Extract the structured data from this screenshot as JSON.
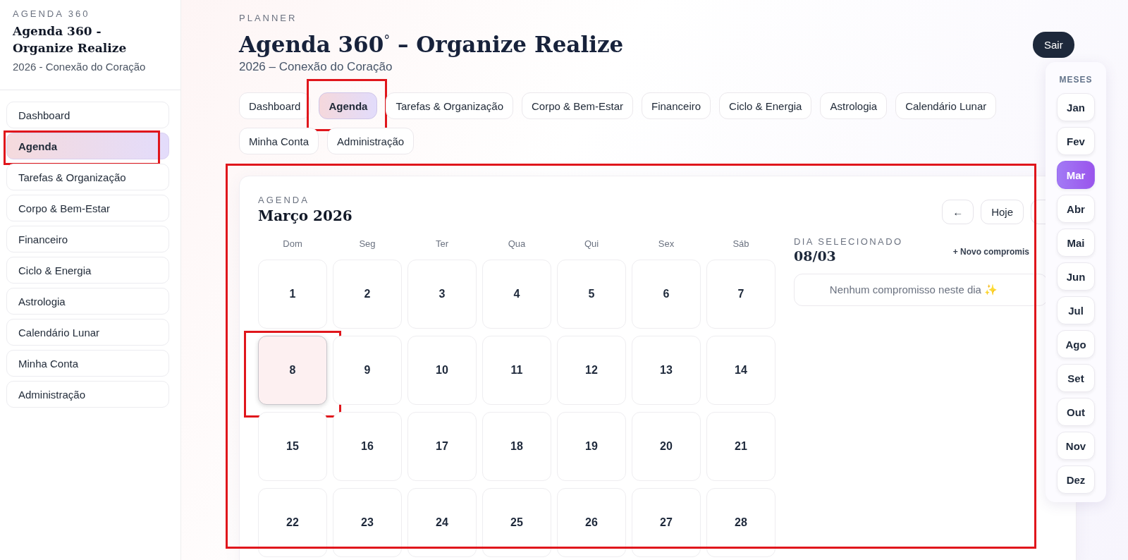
{
  "sidebar": {
    "eyebrow": "AGENDA 360",
    "title": "Agenda 360 - Organize Realize",
    "subtitle": "2026 - Conexão do Coração",
    "items": [
      {
        "label": "Dashboard",
        "selected": false,
        "highlighted": false
      },
      {
        "label": "Agenda",
        "selected": true,
        "highlighted": true
      },
      {
        "label": "Tarefas & Organização",
        "selected": false,
        "highlighted": false
      },
      {
        "label": "Corpo & Bem-Estar",
        "selected": false,
        "highlighted": false
      },
      {
        "label": "Financeiro",
        "selected": false,
        "highlighted": false
      },
      {
        "label": "Ciclo & Energia",
        "selected": false,
        "highlighted": false
      },
      {
        "label": "Astrologia",
        "selected": false,
        "highlighted": false
      },
      {
        "label": "Calendário Lunar",
        "selected": false,
        "highlighted": false
      },
      {
        "label": "Minha Conta",
        "selected": false,
        "highlighted": false
      },
      {
        "label": "Administração",
        "selected": false,
        "highlighted": false
      }
    ]
  },
  "header": {
    "eyebrow": "PLANNER",
    "title": "Agenda 360$^{°}$ – Organize Realize",
    "subtitle": "2026 – Conexão do Coração",
    "logout": "Sair"
  },
  "tabs": [
    {
      "label": "Dashboard",
      "selected": false,
      "highlighted": false
    },
    {
      "label": "Agenda",
      "selected": true,
      "highlighted": true
    },
    {
      "label": "Tarefas & Organização",
      "selected": false,
      "highlighted": false
    },
    {
      "label": "Corpo & Bem-Estar",
      "selected": false,
      "highlighted": false
    },
    {
      "label": "Financeiro",
      "selected": false,
      "highlighted": false
    },
    {
      "label": "Ciclo & Energia",
      "selected": false,
      "highlighted": false
    },
    {
      "label": "Astrologia",
      "selected": false,
      "highlighted": false
    },
    {
      "label": "Calendário Lunar",
      "selected": false,
      "highlighted": false
    },
    {
      "label": "Minha Conta",
      "selected": false,
      "highlighted": false
    },
    {
      "label": "Administração",
      "selected": false,
      "highlighted": false
    }
  ],
  "agenda": {
    "highlighted": true,
    "eyebrow": "AGENDA",
    "title": "Março 2026",
    "prev": "←",
    "today": "Hoje",
    "weekdays": [
      "Dom",
      "Seg",
      "Ter",
      "Qua",
      "Qui",
      "Sex",
      "Sáb"
    ],
    "weeks": [
      [
        {
          "day": "1",
          "selected": false,
          "highlighted": false
        },
        {
          "day": "2",
          "selected": false,
          "highlighted": false
        },
        {
          "day": "3",
          "selected": false,
          "highlighted": false
        },
        {
          "day": "4",
          "selected": false,
          "highlighted": false
        },
        {
          "day": "5",
          "selected": false,
          "highlighted": false
        },
        {
          "day": "6",
          "selected": false,
          "highlighted": false
        },
        {
          "day": "7",
          "selected": false,
          "highlighted": false
        }
      ],
      [
        {
          "day": "8",
          "selected": true,
          "highlighted": true
        },
        {
          "day": "9",
          "selected": false,
          "highlighted": false
        },
        {
          "day": "10",
          "selected": false,
          "highlighted": false
        },
        {
          "day": "11",
          "selected": false,
          "highlighted": false
        },
        {
          "day": "12",
          "selected": false,
          "highlighted": false
        },
        {
          "day": "13",
          "selected": false,
          "highlighted": false
        },
        {
          "day": "14",
          "selected": false,
          "highlighted": false
        }
      ],
      [
        {
          "day": "15",
          "selected": false,
          "highlighted": false
        },
        {
          "day": "16",
          "selected": false,
          "highlighted": false
        },
        {
          "day": "17",
          "selected": false,
          "highlighted": false
        },
        {
          "day": "18",
          "selected": false,
          "highlighted": false
        },
        {
          "day": "19",
          "selected": false,
          "highlighted": false
        },
        {
          "day": "20",
          "selected": false,
          "highlighted": false
        },
        {
          "day": "21",
          "selected": false,
          "highlighted": false
        }
      ],
      [
        {
          "day": "22",
          "selected": false,
          "highlighted": false
        },
        {
          "day": "23",
          "selected": false,
          "highlighted": false
        },
        {
          "day": "24",
          "selected": false,
          "highlighted": false
        },
        {
          "day": "25",
          "selected": false,
          "highlighted": false
        },
        {
          "day": "26",
          "selected": false,
          "highlighted": false
        },
        {
          "day": "27",
          "selected": false,
          "highlighted": false
        },
        {
          "day": "28",
          "selected": false,
          "highlighted": false
        }
      ]
    ],
    "selected_day": {
      "eyebrow": "DIA SELECIONADO",
      "date": "08/03",
      "add": "+ Novo compromis",
      "empty": "Nenhum compromisso neste dia ✨"
    }
  },
  "months": {
    "title": "MESES",
    "items": [
      {
        "label": "Jan",
        "selected": false
      },
      {
        "label": "Fev",
        "selected": false
      },
      {
        "label": "Mar",
        "selected": true
      },
      {
        "label": "Abr",
        "selected": false
      },
      {
        "label": "Mai",
        "selected": false
      },
      {
        "label": "Jun",
        "selected": false
      },
      {
        "label": "Jul",
        "selected": false
      },
      {
        "label": "Ago",
        "selected": false
      },
      {
        "label": "Set",
        "selected": false
      },
      {
        "label": "Out",
        "selected": false
      },
      {
        "label": "Nov",
        "selected": false
      },
      {
        "label": "Dez",
        "selected": false
      }
    ]
  }
}
